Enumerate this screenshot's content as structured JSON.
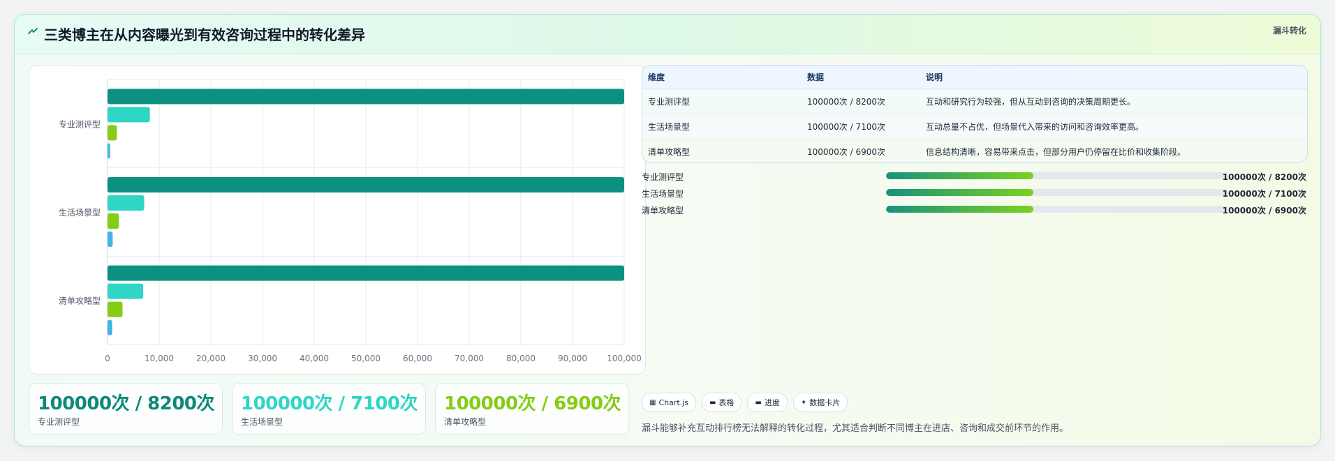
{
  "header": {
    "title": "三类博主在从内容曝光到有效咨询过程中的转化差异",
    "tag": "漏斗转化"
  },
  "colors": {
    "series": [
      "#0e9081",
      "#2fd5c5",
      "#84cc16",
      "#41b3e8"
    ]
  },
  "chart_data": {
    "type": "bar",
    "orientation": "horizontal",
    "categories": [
      "专业测评型",
      "生活场景型",
      "清单攻略型"
    ],
    "series": [
      {
        "values": [
          100000,
          100000,
          100000
        ]
      },
      {
        "values": [
          8200,
          7100,
          6900
        ]
      },
      {
        "values": [
          1800,
          2200,
          2900
        ]
      },
      {
        "values": [
          500,
          1000,
          900
        ]
      }
    ],
    "xlim": [
      0,
      100000
    ],
    "xticks": [
      "0",
      "10,000",
      "20,000",
      "30,000",
      "40,000",
      "50,000",
      "60,000",
      "70,000",
      "80,000",
      "90,000",
      "100,000"
    ],
    "grid": true
  },
  "stats": [
    {
      "value": "100000次 / 8200次",
      "label": "专业测评型",
      "color": "#0e8878"
    },
    {
      "value": "100000次 / 7100次",
      "label": "生活场景型",
      "color": "#2fd5c5"
    },
    {
      "value": "100000次 / 6900次",
      "label": "清单攻略型",
      "color": "#84cc16"
    }
  ],
  "table": {
    "headers": [
      "维度",
      "数据",
      "说明"
    ],
    "rows": [
      [
        "专业测评型",
        "100000次 / 8200次",
        "互动和研究行为较强，但从互动到咨询的决策周期更长。"
      ],
      [
        "生活场景型",
        "100000次 / 7100次",
        "互动总量不占优，但场景代入带来的访问和咨询效率更高。"
      ],
      [
        "清单攻略型",
        "100000次 / 6900次",
        "信息结构清晰，容易带来点击，但部分用户仍停留在比价和收集阶段。"
      ]
    ]
  },
  "progress": [
    {
      "label": "专业测评型",
      "fraction": 0.43,
      "value": "100000次 / 8200次"
    },
    {
      "label": "生活场景型",
      "fraction": 0.43,
      "value": "100000次 / 7100次"
    },
    {
      "label": "清单攻略型",
      "fraction": 0.43,
      "value": "100000次 / 6900次"
    }
  ],
  "tags": [
    {
      "icon": "chart-icon",
      "label": "Chart.js"
    },
    {
      "icon": "table-icon",
      "label": "表格"
    },
    {
      "icon": "progress-icon",
      "label": "进度"
    },
    {
      "icon": "sparkle-icon",
      "label": "数据卡片"
    }
  ],
  "note": "漏斗能够补充互动排行榜无法解释的转化过程，尤其适合判断不同博主在进店、咨询和成交前环节的作用。"
}
